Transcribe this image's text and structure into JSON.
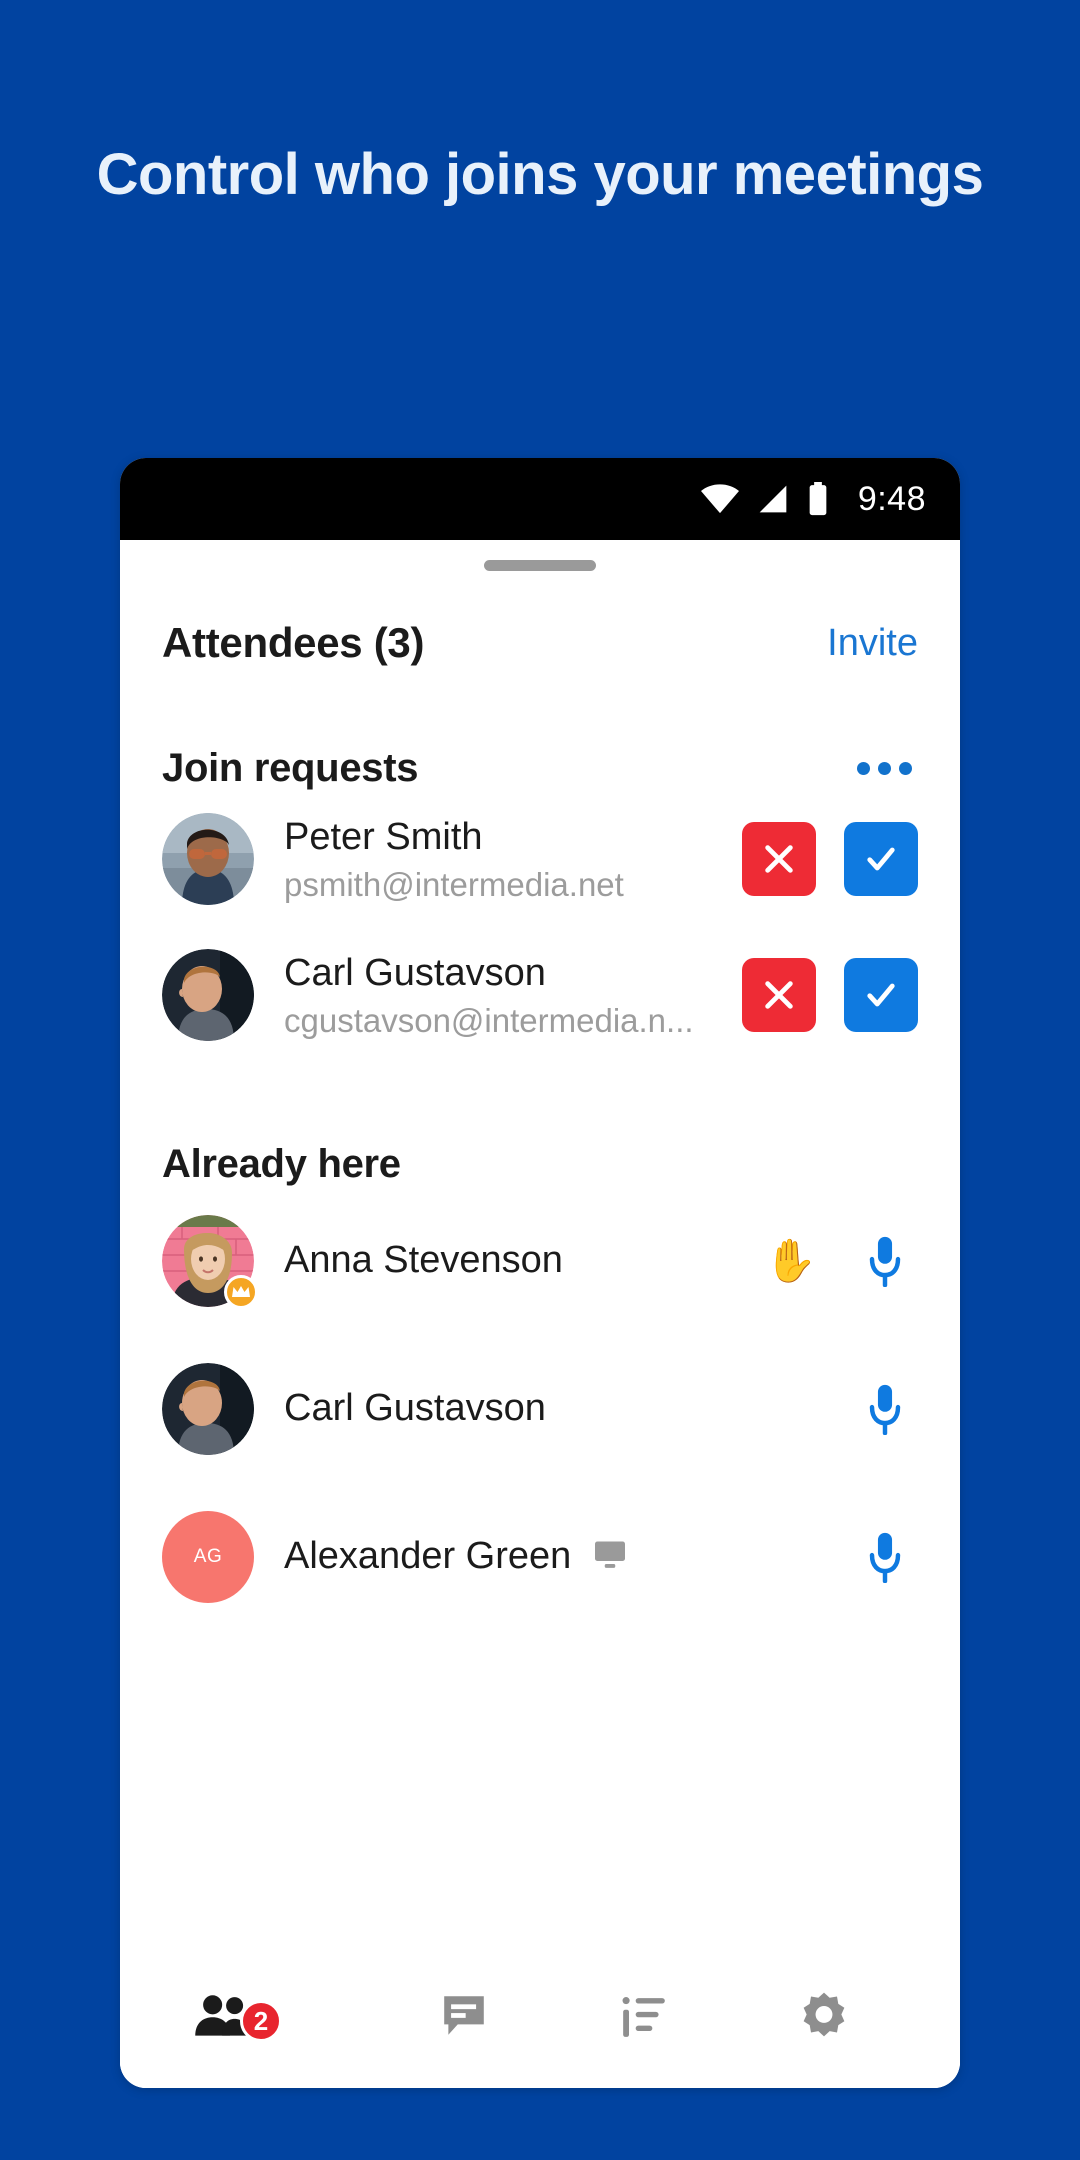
{
  "promo": {
    "headline": "Control who joins your meetings",
    "background_color": "#0143a0",
    "headline_color": "#e8f1fb"
  },
  "status_bar": {
    "time": "9:48",
    "icons": [
      "wifi-icon",
      "cellular-signal-icon",
      "battery-icon"
    ]
  },
  "sheet": {
    "drag_handle": "drag-handle",
    "attendees": {
      "title": "Attendees (3)",
      "invite_label": "Invite",
      "invite_color": "#1a76d2"
    },
    "join_requests": {
      "title": "Join requests",
      "overflow_icon": "more-options-icon",
      "items": [
        {
          "name": "Peter Smith",
          "email": "psmith@intermedia.net",
          "deny_label": "✕",
          "accept_label": "✓",
          "deny_color": "#ee2b35",
          "accept_color": "#0f7ae0"
        },
        {
          "name": "Carl Gustavson",
          "email": "cgustavson@intermedia.n...",
          "deny_label": "✕",
          "accept_label": "✓",
          "deny_color": "#ee2b35",
          "accept_color": "#0f7ae0"
        }
      ]
    },
    "already_here": {
      "title": "Already here",
      "items": [
        {
          "name": "Anna Stevenson",
          "is_host": true,
          "hand_raised": "✋",
          "mic_icon": "microphone-icon",
          "screen_share": false
        },
        {
          "name": "Carl Gustavson",
          "is_host": false,
          "hand_raised": "",
          "mic_icon": "microphone-icon",
          "screen_share": false
        },
        {
          "name": "Alexander Green",
          "initials": "AG",
          "avatar_color": "#f7766e",
          "is_host": false,
          "hand_raised": "",
          "mic_icon": "microphone-icon",
          "screen_share": true
        }
      ]
    }
  },
  "bottom_nav": {
    "items": [
      {
        "icon": "people-icon",
        "badge": "2",
        "active": true
      },
      {
        "icon": "chat-icon",
        "badge": "",
        "active": false
      },
      {
        "icon": "notes-list-icon",
        "badge": "",
        "active": false
      },
      {
        "icon": "settings-gear-icon",
        "badge": "",
        "active": false
      }
    ],
    "active_color": "#1b1b1b",
    "inactive_color": "#8e8e8e",
    "badge_color": "#e8252e"
  }
}
